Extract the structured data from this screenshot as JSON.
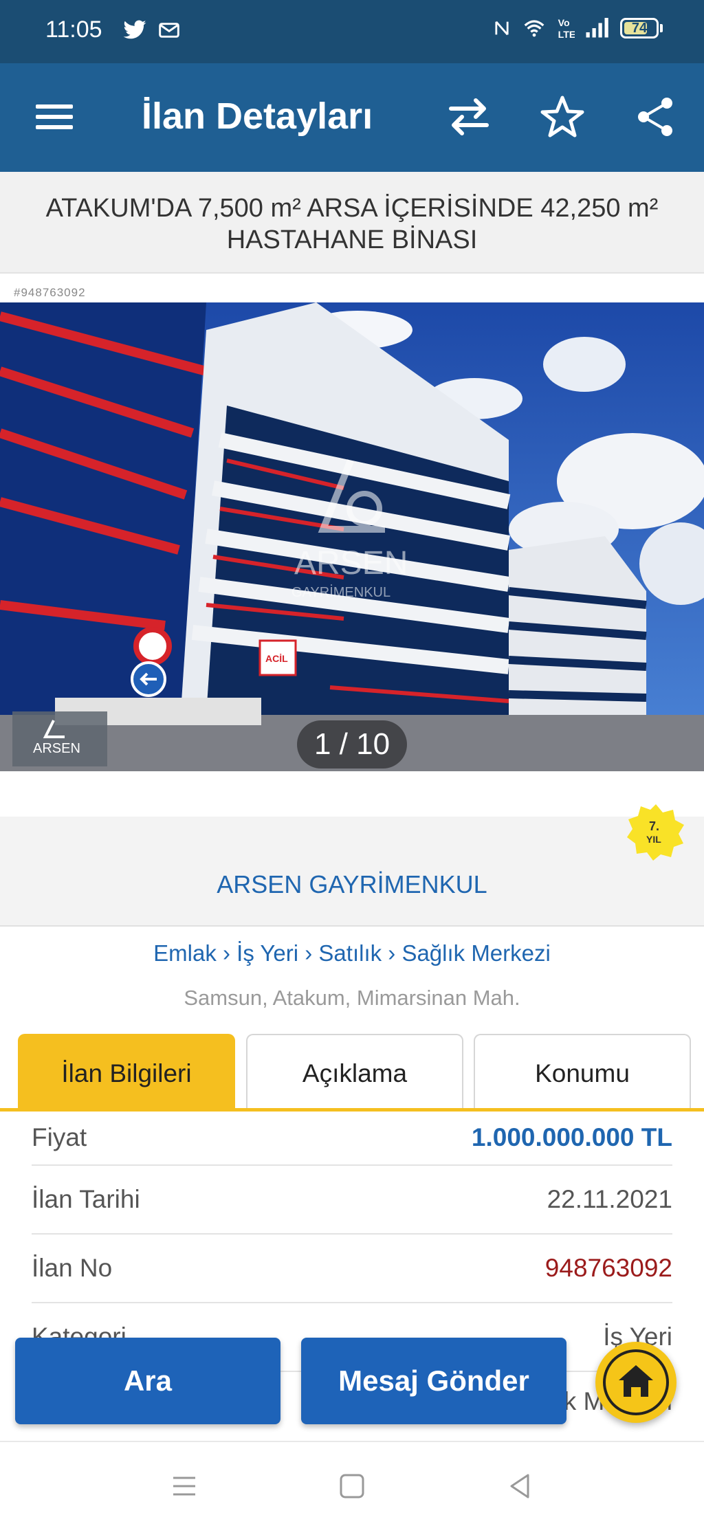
{
  "status_bar": {
    "time": "11:05",
    "battery_level": "74",
    "icons": [
      "twitter-icon",
      "sim-message-icon",
      "nfc-icon",
      "wifi-icon",
      "volte-icon",
      "signal-icon",
      "battery-icon"
    ]
  },
  "app_bar": {
    "title": "İlan Detayları",
    "icons": [
      "menu-icon",
      "compare-icon",
      "star-icon",
      "share-icon"
    ]
  },
  "listing": {
    "title": "ATAKUM'DA 7,500 m² ARSA İÇERİSİNDE 42,250 m² HASTAHANE BİNASI",
    "id_tag": "#948763092",
    "photo_counter": "1 / 10",
    "watermark_text": "ARSEN",
    "watermark_subtext": "GAYRİMENKUL",
    "sign_text": "ACİL"
  },
  "agency": {
    "name": "ARSEN GAYRİMENKUL",
    "badge_text": "7.",
    "badge_subtext": "YIL"
  },
  "breadcrumb": {
    "items": [
      "Emlak",
      "İş Yeri",
      "Satılık",
      "Sağlık Merkezi"
    ],
    "separator": "›"
  },
  "location": "Samsun, Atakum, Mimarsinan Mah.",
  "tabs": [
    {
      "label": "İlan Bilgileri",
      "active": true
    },
    {
      "label": "Açıklama",
      "active": false
    },
    {
      "label": "Konumu",
      "active": false
    }
  ],
  "info_rows": [
    {
      "label": "Fiyat",
      "value": "1.000.000.000 TL",
      "value_color": "#1f66b0"
    },
    {
      "label": "İlan Tarihi",
      "value": "22.11.2021",
      "value_color": "#555555"
    },
    {
      "label": "İlan No",
      "value": "948763092",
      "value_color": "#9b1b1b"
    },
    {
      "label": "Kategori",
      "value": "İş Yeri",
      "value_color": "#555555"
    },
    {
      "label": "",
      "value": "Sağlık Merkezi",
      "value_color": "#555555"
    }
  ],
  "buttons": {
    "call_label": "Ara",
    "message_label": "Mesaj Gönder"
  },
  "colors": {
    "status_bar": "#1b4d73",
    "app_bar": "#1f5f93",
    "accent_yellow": "#f5bf1f",
    "link_blue": "#1f66b0",
    "button_blue": "#1e63b8"
  }
}
